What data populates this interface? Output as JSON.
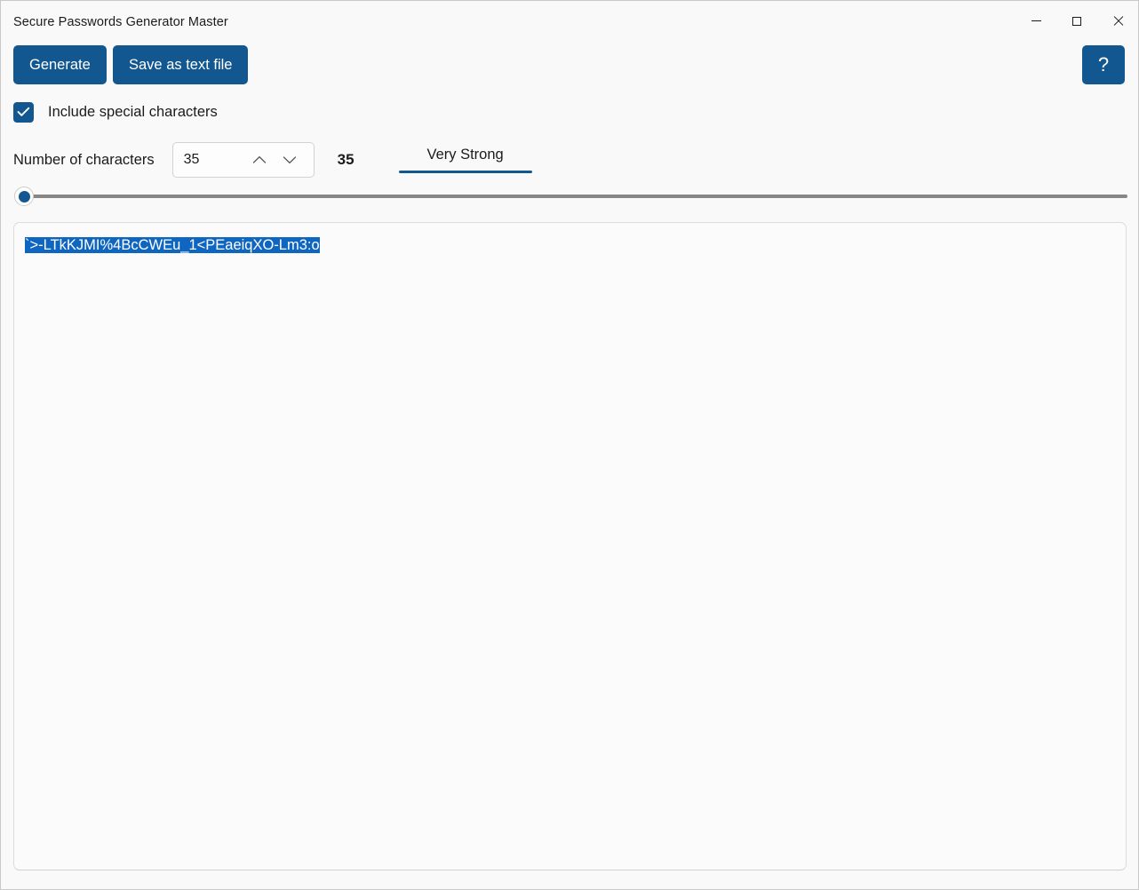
{
  "window": {
    "title": "Secure Passwords Generator Master",
    "caption": {
      "minimize": "minimize",
      "maximize": "maximize",
      "close": "close"
    }
  },
  "toolbar": {
    "generate_label": "Generate",
    "save_label": "Save as text file",
    "help_label": "?"
  },
  "options": {
    "special_characters_label": "Include special characters",
    "special_characters_checked": "true"
  },
  "length": {
    "label": "Number of characters",
    "spinner_value": "35",
    "count_display": "35",
    "strength_label": "Very Strong",
    "slider_position_percent": "0"
  },
  "output": {
    "password": "`>-LTkKJMI%4BcCWEu_1<PEaeiqXO-Lm3:o",
    "selected": "true"
  },
  "colors": {
    "accent": "#12578f",
    "selection": "#0f66c0",
    "window_background": "#f9f9f9",
    "output_background": "#fbfbfb",
    "slider_track": "#868686"
  }
}
